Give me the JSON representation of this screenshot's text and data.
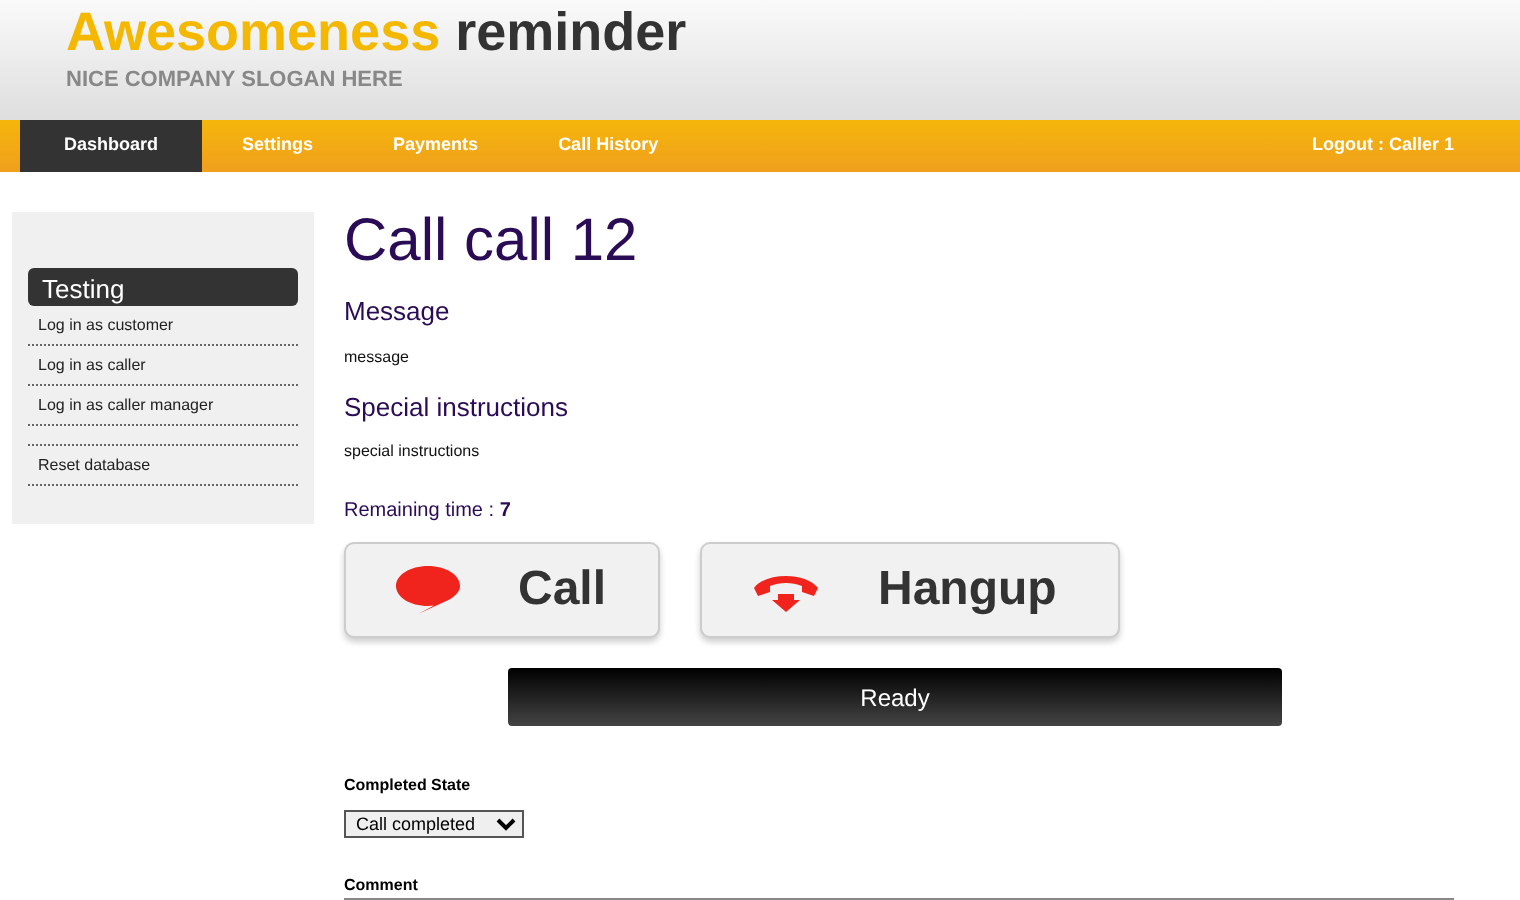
{
  "header": {
    "brand_highlight": "Awesomeness",
    "brand_rest": "reminder",
    "slogan": "NICE COMPANY SLOGAN HERE"
  },
  "nav": {
    "items": [
      {
        "label": "Dashboard",
        "selected": true
      },
      {
        "label": "Settings",
        "selected": false
      },
      {
        "label": "Payments",
        "selected": false
      },
      {
        "label": "Call History",
        "selected": false
      }
    ],
    "logout": "Logout : Caller 1"
  },
  "sidebar": {
    "title": "Testing",
    "items": [
      {
        "label": "Log in as customer",
        "kind": "link"
      },
      {
        "label": "Log in as caller",
        "kind": "link"
      },
      {
        "label": "Log in as caller manager",
        "kind": "link"
      },
      {
        "label": "Reset database",
        "kind": "gap-link"
      }
    ]
  },
  "main": {
    "title": "Call call 12",
    "sections": [
      {
        "heading": "Message",
        "text": "message"
      },
      {
        "heading": "Special instructions",
        "text": "special instructions"
      }
    ],
    "remaining_label": "Remaining time : ",
    "remaining_value": "7",
    "buttons": [
      {
        "label": "Call",
        "kind": "call"
      },
      {
        "label": "Hangup",
        "kind": "hangup"
      }
    ],
    "status": "Ready",
    "completed_state": {
      "label": "Completed State",
      "value": "Call completed"
    },
    "comment": {
      "label": "Comment"
    }
  }
}
